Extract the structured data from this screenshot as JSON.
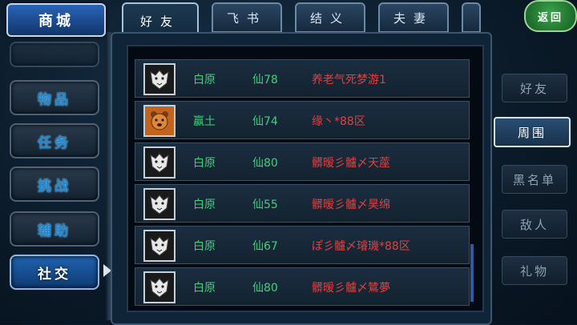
{
  "left_menu": {
    "shop": "商城",
    "items": [
      "物品",
      "任务",
      "挑战",
      "辅助",
      "社交"
    ]
  },
  "tabs": [
    "好友",
    "飞书",
    "结义",
    "夫妻"
  ],
  "back": "返回",
  "friends": [
    {
      "avatar": "white-tiger-icon",
      "race": "白原",
      "level": "仙78",
      "name": "养老气死梦游1"
    },
    {
      "avatar": "orange-bear-icon",
      "race": "赢土",
      "level": "仙74",
      "name": "缘丶*88区"
    },
    {
      "avatar": "white-tiger-icon",
      "race": "白原",
      "level": "仙80",
      "name": "髒暧彡髗〆天蓙"
    },
    {
      "avatar": "white-tiger-icon",
      "race": "白原",
      "level": "仙55",
      "name": "髒暧彡髗〆昊绵"
    },
    {
      "avatar": "white-tiger-icon",
      "race": "白原",
      "level": "仙67",
      "name": "ぽ彡髗〆璿璣*88区"
    },
    {
      "avatar": "white-tiger-icon",
      "race": "白原",
      "level": "仙80",
      "name": "髒暧彡髗〆鷥夢"
    }
  ],
  "right_menu": [
    "好友",
    "周围",
    "黑名单",
    "敌人",
    "礼物"
  ],
  "colors": {
    "race": "#3fd07a",
    "name": "#e04040",
    "accent": "#1f63b0"
  }
}
